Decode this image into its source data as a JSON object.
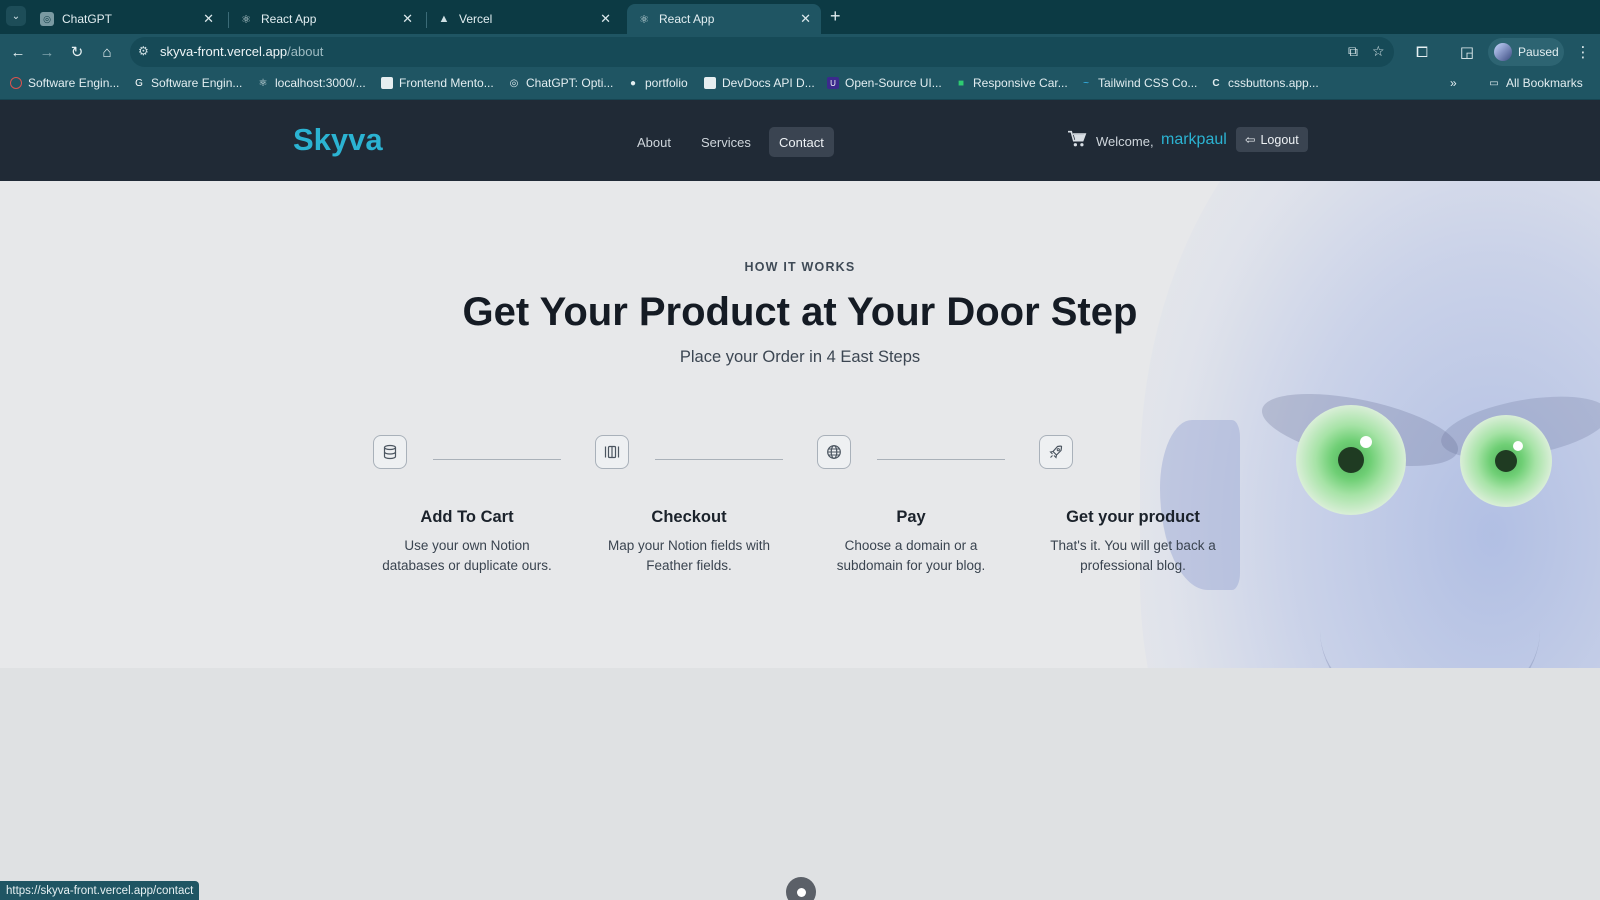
{
  "browser": {
    "tabs": [
      {
        "title": "ChatGPT",
        "active": false
      },
      {
        "title": "React App",
        "active": false
      },
      {
        "title": "Vercel",
        "active": false
      },
      {
        "title": "React App",
        "active": true
      }
    ],
    "address": {
      "host": "skyva-front.vercel.app",
      "path": "/about"
    },
    "profile_label": "Paused",
    "bookmarks": [
      "Software Engin...",
      "Software Engin...",
      "localhost:3000/...",
      "Frontend Mento...",
      "ChatGPT: Opti...",
      "portfolio",
      "DevDocs API D...",
      "Open-Source UI...",
      "Responsive Car...",
      "Tailwind CSS Co...",
      "cssbuttons.app..."
    ],
    "all_bookmarks_label": "All Bookmarks",
    "status_url": "https://skyva-front.vercel.app/contact"
  },
  "site": {
    "brand": "Skyva",
    "nav": [
      {
        "label": "About",
        "active": false
      },
      {
        "label": "Services",
        "active": false
      },
      {
        "label": "Contact",
        "active": true
      }
    ],
    "welcome": "Welcome,",
    "username": "markpaul",
    "logout_label": "Logout"
  },
  "how_it_works": {
    "eyebrow": "HOW IT WORKS",
    "headline": "Get Your Product at Your Door Step",
    "subline": "Place your Order in 4 East Steps",
    "steps": [
      {
        "icon": "database-icon",
        "title": "Add To Cart",
        "desc_line1": "Use your own Notion",
        "desc_line2": "databases or duplicate ours."
      },
      {
        "icon": "columns-icon",
        "title": "Checkout",
        "desc_line1": "Map your Notion fields with",
        "desc_line2": "Feather fields."
      },
      {
        "icon": "globe-icon",
        "title": "Pay",
        "desc_line1": "Choose a domain or a",
        "desc_line2": "subdomain for your blog."
      },
      {
        "icon": "rocket-icon",
        "title": "Get your product",
        "desc_line1": "That's it. You will get back a",
        "desc_line2": "professional blog."
      }
    ]
  },
  "colors": {
    "brand": "#2bb3d2",
    "navbar": "#202a36",
    "page_bg": "#e7e8ea",
    "browser_chrome": "#1f5563"
  }
}
